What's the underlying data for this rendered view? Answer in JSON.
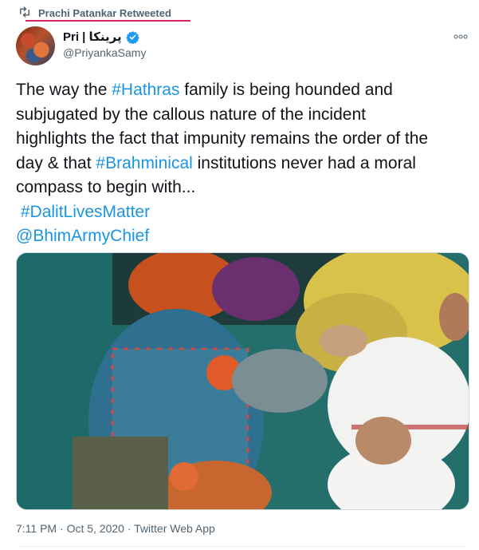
{
  "retweet": {
    "icon": "retweet-icon",
    "text": "Prachi Patankar Retweeted",
    "underline_color": "#e0245e"
  },
  "author": {
    "name": "Pri | پرینکا",
    "handle": "@PriyankaSamy",
    "verified_icon": "verified-badge-icon"
  },
  "more_icon": "more-options-icon",
  "tweet": {
    "line1_pre": "The way the ",
    "line1_tag": "#Hathras",
    "line1_post": " family is being hounded and",
    "line2": "subjugated by the callous nature of the incident",
    "line3": "highlights the fact that impunity remains the order of the",
    "line4_pre": "day & that ",
    "line4_tag": "#Brahminical",
    "line4_post": " institutions never had a moral",
    "line5": "compass to begin with...",
    "line6_tag": "#DalitLivesMatter",
    "line7_mention": "@BhimArmyChief"
  },
  "meta": {
    "time": "7:11 PM",
    "date": "Oct 5, 2020",
    "source": "Twitter Web App",
    "sep": " · "
  },
  "colors": {
    "link": "#1b95e0",
    "text": "#0f1419",
    "secondary": "#536471"
  }
}
